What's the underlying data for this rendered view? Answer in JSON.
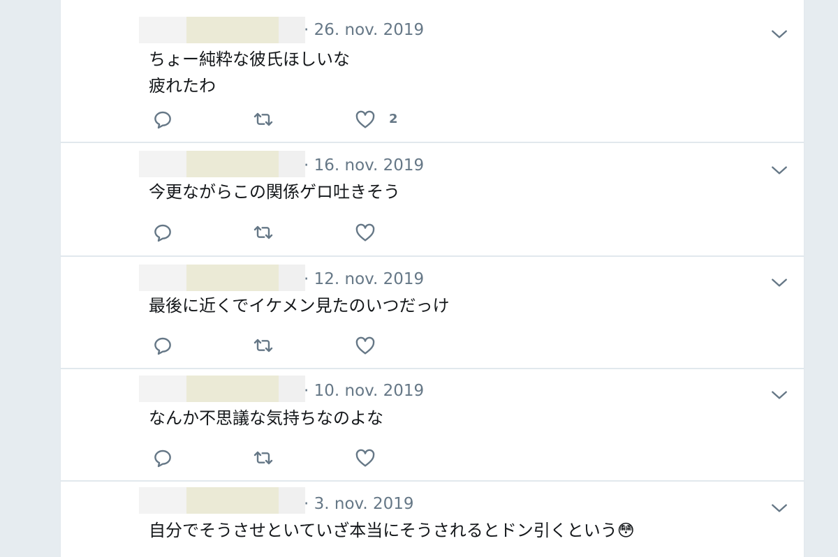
{
  "tweets": [
    {
      "date": "· 26. nov. 2019",
      "text": "ちょー純粋な彼氏ほしいな\n疲れたわ",
      "likes": "2"
    },
    {
      "date": "· 16. nov. 2019",
      "text": "今更ながらこの関係ゲロ吐きそう",
      "likes": ""
    },
    {
      "date": "· 12. nov. 2019",
      "text": "最後に近くでイケメン見たのいつだっけ",
      "likes": ""
    },
    {
      "date": "· 10. nov. 2019",
      "text": "なんか不思議な気持ちなのよな",
      "likes": ""
    },
    {
      "date": "· 3. nov. 2019",
      "text": "自分でそうさせといていざ本当にそうされるとドン引くという😳",
      "likes": ""
    }
  ],
  "icons": {
    "reply": "reply-icon",
    "retweet": "retweet-icon",
    "like": "heart-icon",
    "menu": "chevron-down-icon"
  },
  "colors": {
    "icon": "#657786",
    "text": "#14171a",
    "divider": "#e1e8ed",
    "background": "#e6ecf0"
  }
}
